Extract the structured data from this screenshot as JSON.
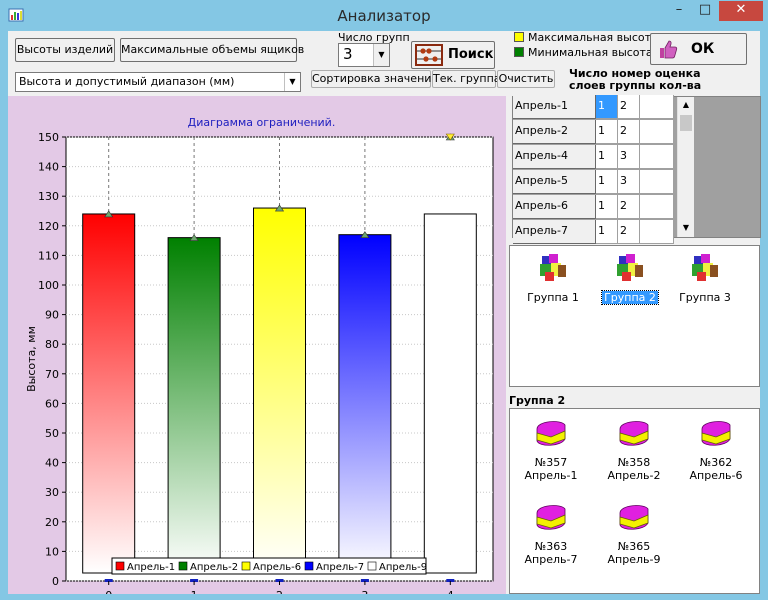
{
  "window": {
    "title": "Анализатор",
    "minimize": "–",
    "maximize": "□",
    "close": "✕"
  },
  "toolbar": {
    "heights_button": "Высоты изделий",
    "max_volumes_button": "Максимальные объемы ящиков",
    "group_count_label": "Число групп",
    "group_count_value": "3",
    "search_button": "Поиск",
    "ok_button": "ОК",
    "mode_select_value": "Высота и допустимый диапазон (мм)",
    "sort_button": "Сортировка значений",
    "current_group_button": "Тек. группа",
    "clear_button": "Очистить",
    "legend_max": "Максимальная высота",
    "legend_min": "Минимальная высота",
    "legend_max_color": "#ffff00",
    "legend_min_color": "#008000",
    "columns_header_line1": "Число номер оценка",
    "columns_header_line2": "слоев группы кол-ва"
  },
  "chart_data": {
    "type": "bar",
    "title": "Диаграмма ограничений.",
    "xlabel": "",
    "ylabel": "Высота, мм",
    "ylim": [
      0,
      150
    ],
    "yticks": [
      "0",
      "10",
      "20",
      "30",
      "40",
      "50",
      "60",
      "70",
      "80",
      "90",
      "100",
      "110",
      "120",
      "130",
      "140",
      "150"
    ],
    "categories": [
      "0",
      "1",
      "2",
      "3",
      "4"
    ],
    "values": [
      124,
      116,
      126,
      117,
      124
    ],
    "max_markers": [
      124,
      116,
      126,
      117,
      150
    ],
    "min_markers": [
      0,
      0,
      0,
      0,
      0
    ],
    "colors": [
      "#ff0000",
      "#008000",
      "#ffff00",
      "#0000ff",
      "#ffffff"
    ],
    "legend_position": "bottom",
    "grid": true,
    "series": [
      {
        "name": "Апрель-1",
        "color": "#ff0000"
      },
      {
        "name": "Апрель-2",
        "color": "#008000"
      },
      {
        "name": "Апрель-6",
        "color": "#ffff00"
      },
      {
        "name": "Апрель-7",
        "color": "#0000ff"
      },
      {
        "name": "Апрель-9",
        "color": "#ffffff"
      }
    ]
  },
  "grid": {
    "rows": [
      {
        "name": "Апрель-1",
        "layers": "1",
        "group": "2",
        "score": ""
      },
      {
        "name": "Апрель-2",
        "layers": "1",
        "group": "2",
        "score": ""
      },
      {
        "name": "Апрель-4",
        "layers": "1",
        "group": "3",
        "score": ""
      },
      {
        "name": "Апрель-5",
        "layers": "1",
        "group": "3",
        "score": ""
      },
      {
        "name": "Апрель-6",
        "layers": "1",
        "group": "2",
        "score": ""
      },
      {
        "name": "Апрель-7",
        "layers": "1",
        "group": "2",
        "score": ""
      }
    ]
  },
  "groups": {
    "items": [
      {
        "label": "Группа 1"
      },
      {
        "label": "Группа 2"
      },
      {
        "label": "Группа 3"
      }
    ],
    "selected_header": "Группа 2"
  },
  "items": [
    {
      "number": "№357",
      "name": "Апрель-1"
    },
    {
      "number": "№358",
      "name": "Апрель-2"
    },
    {
      "number": "№362",
      "name": "Апрель-6"
    },
    {
      "number": "№363",
      "name": "Апрель-7"
    },
    {
      "number": "№365",
      "name": "Апрель-9"
    }
  ]
}
